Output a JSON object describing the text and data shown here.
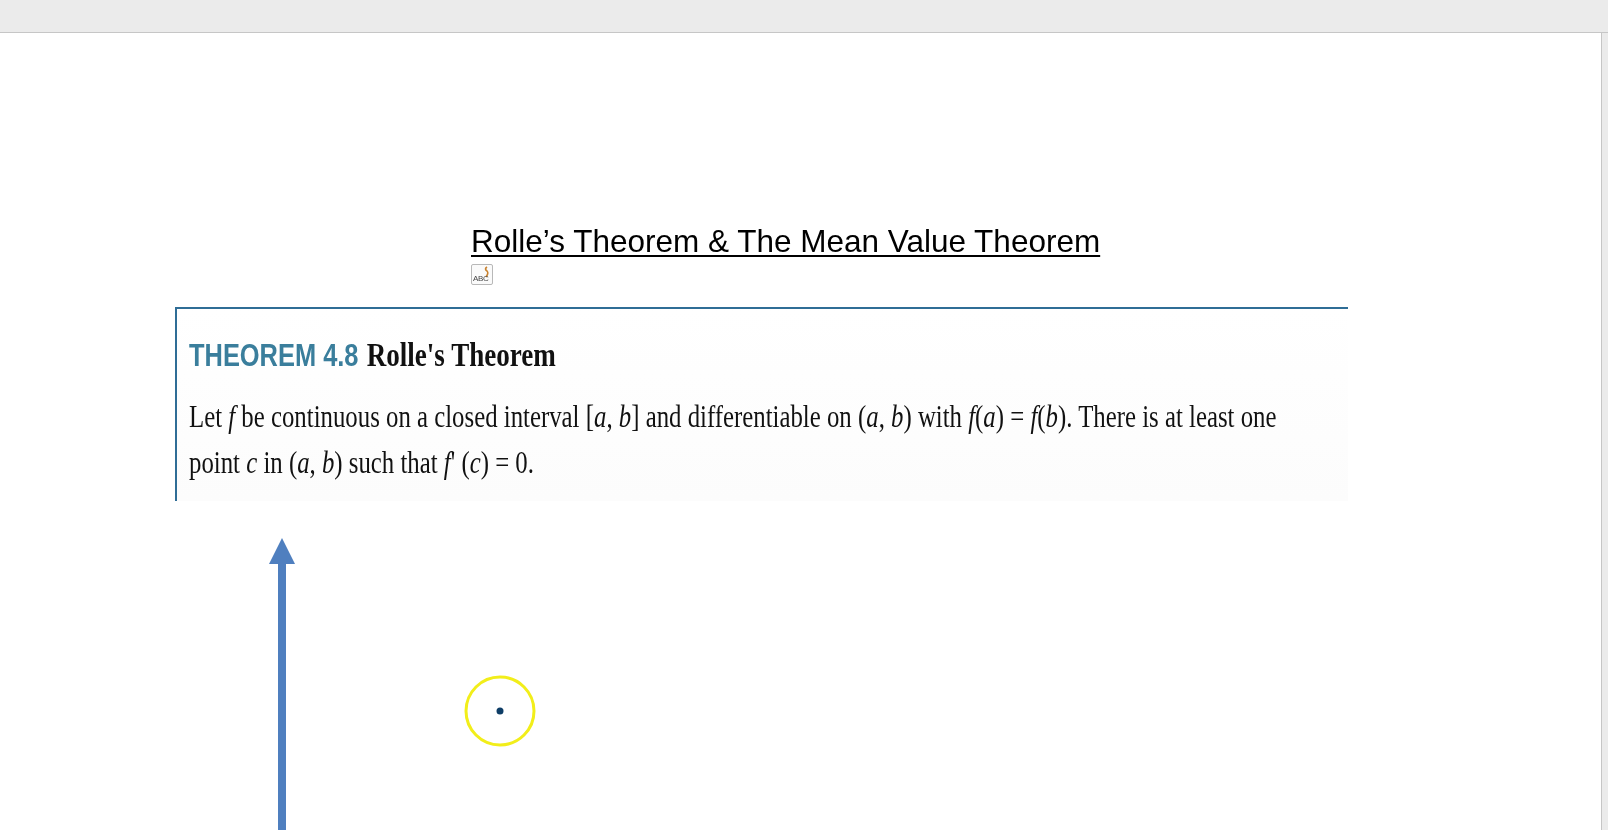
{
  "document": {
    "title": "Rolle’s Theorem & The Mean Value Theorem",
    "object_icon_label": "ABC"
  },
  "theorem": {
    "label": "THEOREM 4.8",
    "name": "Rolle's Theorem",
    "statement": "Let *f* be continuous on a closed interval [*a*, *b*] and differentiable on (*a*, *b*) with *f*(*a*) = *f*(*b*). There is at least one point *c* in (*a*, *b*) such that *f*' (*c*) = 0."
  }
}
